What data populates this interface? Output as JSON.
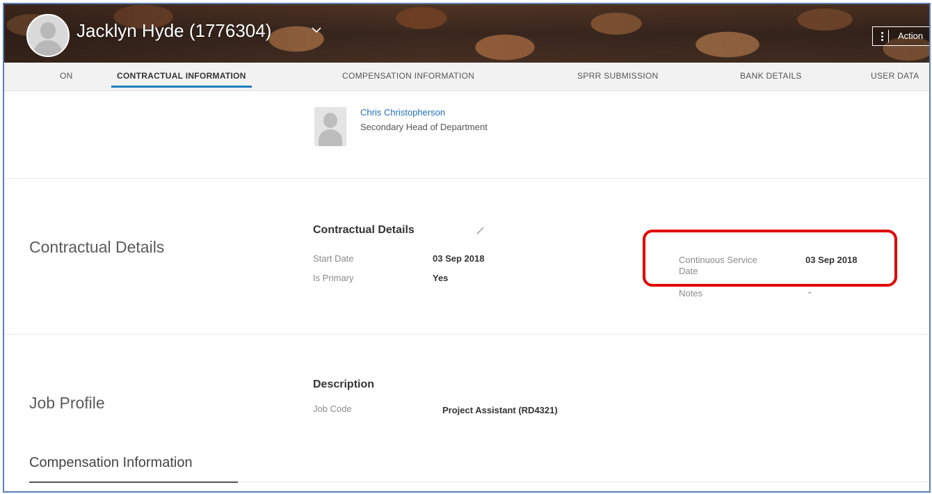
{
  "header": {
    "employee_name": "Jacklyn Hyde (1776304)",
    "actions_label": "Action"
  },
  "tabs": [
    {
      "label": "ON",
      "active": false
    },
    {
      "label": "CONTRACTUAL INFORMATION",
      "active": true
    },
    {
      "label": "COMPENSATION INFORMATION",
      "active": false
    },
    {
      "label": "SPRR SUBMISSION",
      "active": false
    },
    {
      "label": "BANK DETAILS",
      "active": false
    },
    {
      "label": "USER DATA",
      "active": false
    }
  ],
  "manager": {
    "name": "Chris Christopherson",
    "role": "Secondary Head of Department"
  },
  "contractual": {
    "section_title": "Contractual Details",
    "card_title": "Contractual Details",
    "fields_left": [
      {
        "label": "Start Date",
        "value": "03 Sep 2018"
      },
      {
        "label": "Is Primary",
        "value": "Yes"
      }
    ],
    "continuous_service": {
      "label_line1": "Continuous Service",
      "label_line2": "Date",
      "value": "03 Sep 2018"
    },
    "notes": {
      "label": "Notes",
      "value": "-"
    }
  },
  "job_profile": {
    "section_title": "Job Profile",
    "card_title": "Description",
    "job_code_label": "Job Code",
    "job_code_value": "Project Assistant (RD4321)"
  },
  "compensation": {
    "section_title": "Compensation Information"
  },
  "colors": {
    "accent": "#1e7fc0",
    "highlight": "#e00000",
    "link": "#1f6fb6"
  }
}
